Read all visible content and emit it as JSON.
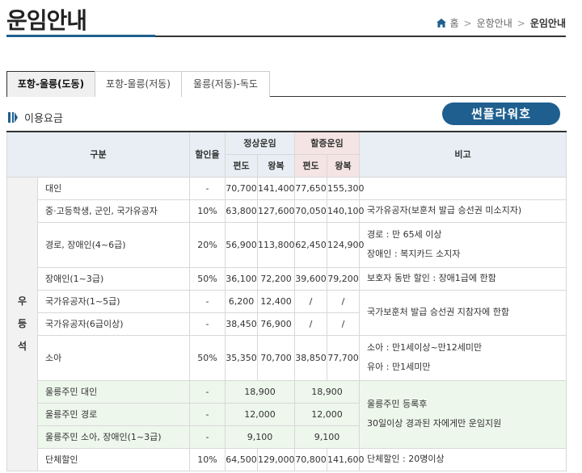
{
  "page_title": "운임안내",
  "breadcrumb": {
    "home": "홈",
    "level1": "운항안내",
    "current": "운임안내"
  },
  "tabs": [
    {
      "label": "포항-울릉(도동)",
      "active": true
    },
    {
      "label": "포항-울릉(저동)",
      "active": false
    },
    {
      "label": "울릉(저동)-독도",
      "active": false
    }
  ],
  "section_title": "이용요금",
  "ship_button": "썬플라워호",
  "table": {
    "headers": {
      "category": "구분",
      "discount": "할인율",
      "normal": "정상운임",
      "surcharge": "할증운임",
      "remarks": "비고",
      "oneway": "편도",
      "roundtrip": "왕복"
    },
    "seat_class": [
      "우",
      "등",
      "석"
    ],
    "rows": [
      {
        "name": "대인",
        "rate": "-",
        "n1": "70,700",
        "n2": "141,400",
        "s1": "77,650",
        "s2": "155,300",
        "note": ""
      },
      {
        "name": "중·고등학생, 군인, 국가유공자",
        "rate": "10%",
        "n1": "63,800",
        "n2": "127,600",
        "s1": "70,050",
        "s2": "140,100",
        "note": "국가유공자(보훈처 발급 승선권 미소지자)"
      },
      {
        "name": "경로, 장애인(4~6급)",
        "rate": "20%",
        "n1": "56,900",
        "n2": "113,800",
        "s1": "62,450",
        "s2": "124,900",
        "note_lines": [
          "경로 : 만 65세 이상",
          "장애인 : 복지카드 소지자"
        ]
      },
      {
        "name": "장애인(1~3급)",
        "rate": "50%",
        "n1": "36,100",
        "n2": "72,200",
        "s1": "39,600",
        "s2": "79,200",
        "note": "보호자 동반 할인 : 장애1급에 한함"
      },
      {
        "name": "국가유공자(1~5급)",
        "rate": "-",
        "n1": "6,200",
        "n2": "12,400",
        "s1": "/",
        "s2": "/",
        "note": "국가보훈처 발급 승선권 지참자에 한함"
      },
      {
        "name": "국가유공자(6급이상)",
        "rate": "-",
        "n1": "38,450",
        "n2": "76,900",
        "s1": "/",
        "s2": "/"
      },
      {
        "name": "소아",
        "rate": "50%",
        "n1": "35,350",
        "n2": "70,700",
        "s1": "38,850",
        "s2": "77,700",
        "note_lines": [
          "소아 : 만1세이상~만12세미만",
          "유아 : 만1세미만"
        ]
      },
      {
        "name": "울릉주민 대인",
        "rate": "-",
        "normal": "18,900",
        "surcharge": "18,900",
        "note_lines": [
          "울릉주민 등록후",
          "30일이상 경과된 자에게만 운임지원"
        ]
      },
      {
        "name": "울릉주민 경로",
        "rate": "-",
        "normal": "12,000",
        "surcharge": "12,000"
      },
      {
        "name": "울릉주민 소아, 장애인(1~3급)",
        "rate": "-",
        "normal": "9,100",
        "surcharge": "9,100"
      },
      {
        "name": "단체할인",
        "rate": "10%",
        "n1": "64,500",
        "n2": "129,000",
        "s1": "70,800",
        "s2": "141,600",
        "note": "단체할인 : 20명이상"
      }
    ]
  },
  "colors": {
    "accent": "#1e5f8f",
    "header_bg": "#e8eef3",
    "surcharge_bg": "#f5e4e4",
    "resident_bg": "#eef7ec"
  }
}
